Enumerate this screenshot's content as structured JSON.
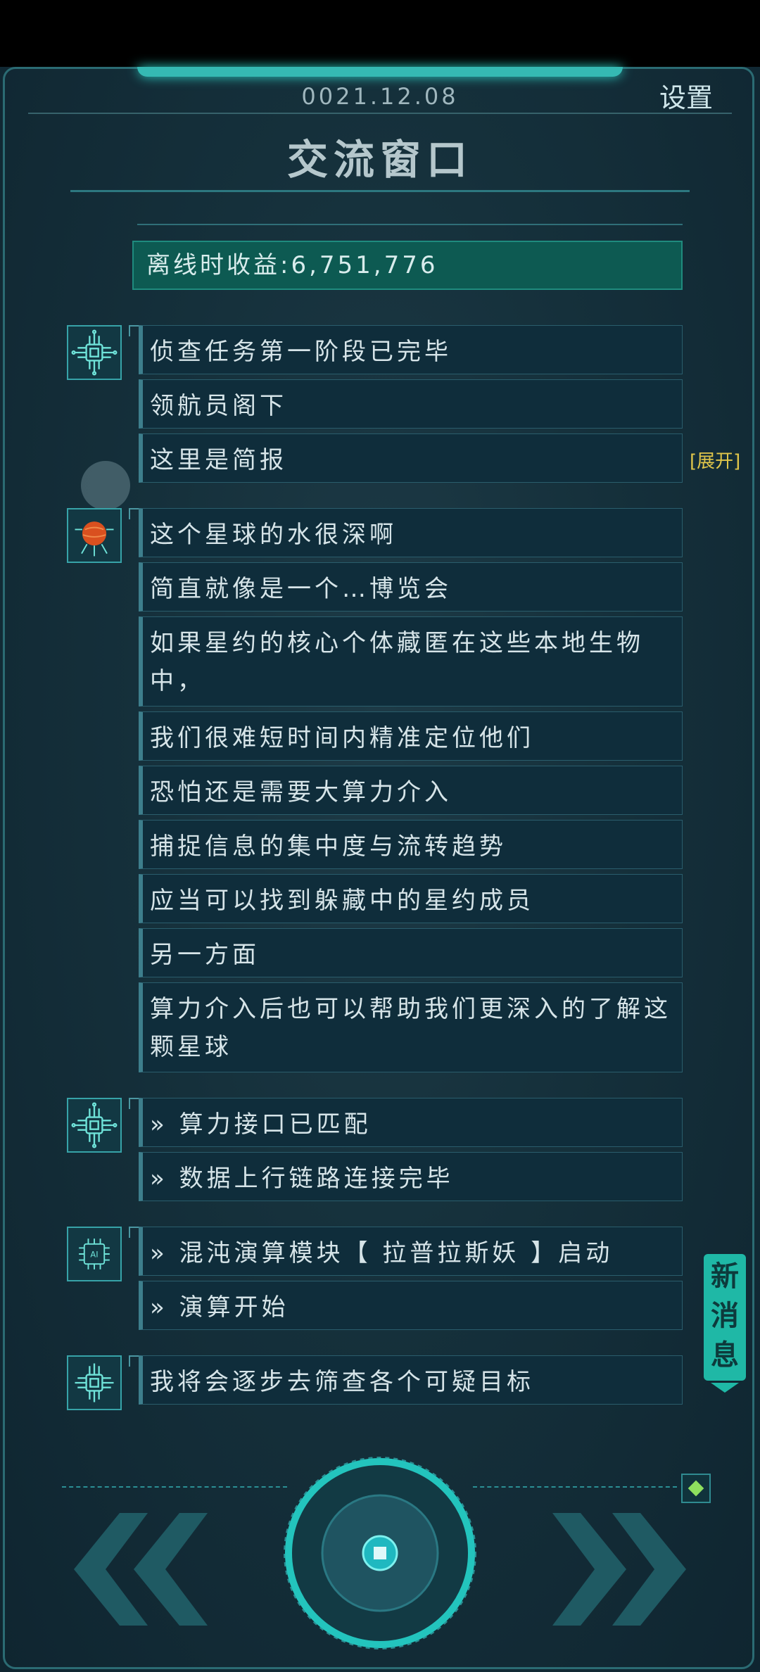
{
  "header": {
    "date": "0021.12.08",
    "settings_label": "设置",
    "title": "交流窗口"
  },
  "earnings": {
    "text": "离线时收益:6,751,776"
  },
  "expand_label": "[展开]",
  "new_message_label": [
    "新",
    "消",
    "息"
  ],
  "messages": [
    {
      "speaker": "chip",
      "lines": [
        "侦查任务第一阶段已完毕",
        "领航员阁下",
        "这里是简报"
      ]
    },
    {
      "speaker": "planet",
      "lines": [
        "这个星球的水很深啊",
        "简直就像是一个…博览会",
        "如果星约的核心个体藏匿在这些本地生物中，",
        "我们很难短时间内精准定位他们",
        "恐怕还是需要大算力介入",
        "捕捉信息的集中度与流转趋势",
        "应当可以找到躲藏中的星约成员",
        "另一方面",
        "算力介入后也可以帮助我们更深入的了解这颗星球"
      ]
    },
    {
      "speaker": "chip",
      "lines": [
        "» 算力接口已匹配",
        "» 数据上行链路连接完毕"
      ]
    },
    {
      "speaker": "ai",
      "lines": [
        "» 混沌演算模块【 拉普拉斯妖 】启动",
        "» 演算开始"
      ]
    },
    {
      "speaker": "chip",
      "lines": [
        "我将会逐步去筛查各个可疑目标"
      ]
    }
  ],
  "colors": {
    "accent": "#35b9b3",
    "earnings_bg": "#0d5a52",
    "expand": "#e0c64a",
    "new_msg_bg": "#1fb8a6",
    "diamond": "#8ee05e"
  }
}
